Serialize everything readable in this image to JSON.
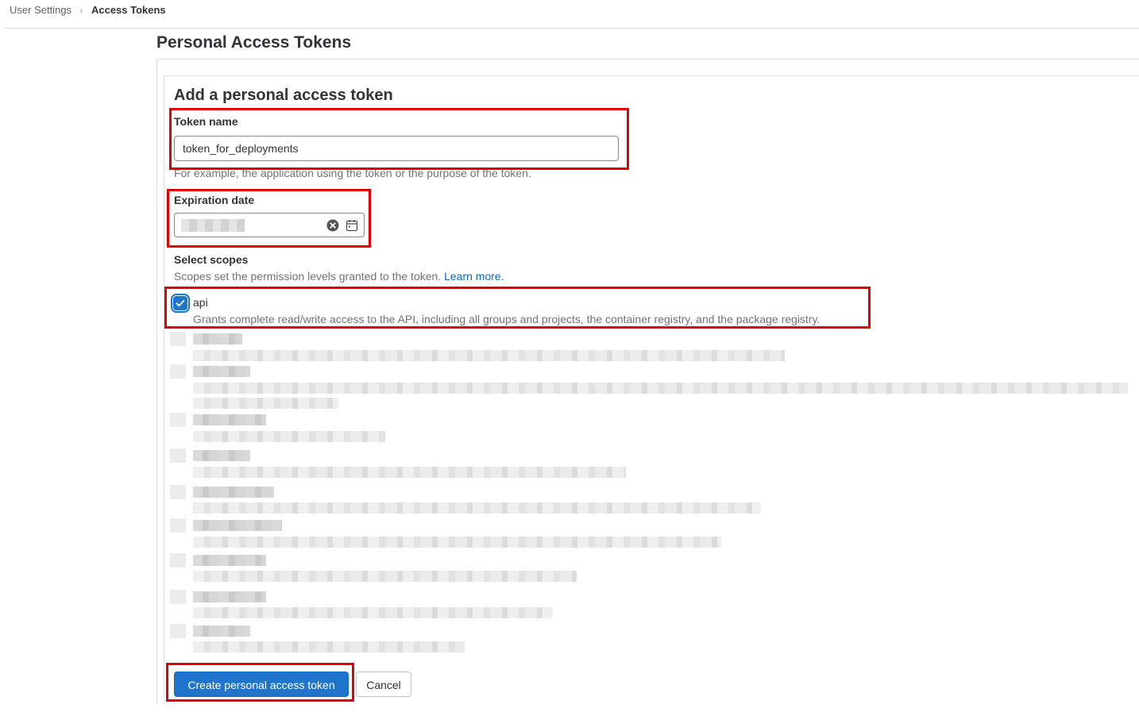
{
  "breadcrumb": {
    "parent": "User Settings",
    "separator": "›",
    "current": "Access Tokens"
  },
  "page": {
    "title": "Personal Access Tokens"
  },
  "form": {
    "heading": "Add a personal access token",
    "token_name": {
      "label": "Token name",
      "value": "token_for_deployments",
      "help": "For example, the application using the token or the purpose of the token."
    },
    "expiration": {
      "label": "Expiration date",
      "value": "",
      "clear_icon": "clear-circle-icon",
      "calendar_icon": "calendar-icon"
    },
    "scopes": {
      "label": "Select scopes",
      "help": "Scopes set the permission levels granted to the token.",
      "learn_more": "Learn more.",
      "items": [
        {
          "name": "api",
          "checked": true,
          "description": "Grants complete read/write access to the API, including all groups and projects, the container registry, and the package registry."
        }
      ]
    },
    "submit_label": "Create personal access token",
    "cancel_label": "Cancel"
  },
  "colors": {
    "primary": "#1f75cb",
    "link": "#1068bf",
    "highlight": "#e30000",
    "muted_text": "#737278"
  }
}
